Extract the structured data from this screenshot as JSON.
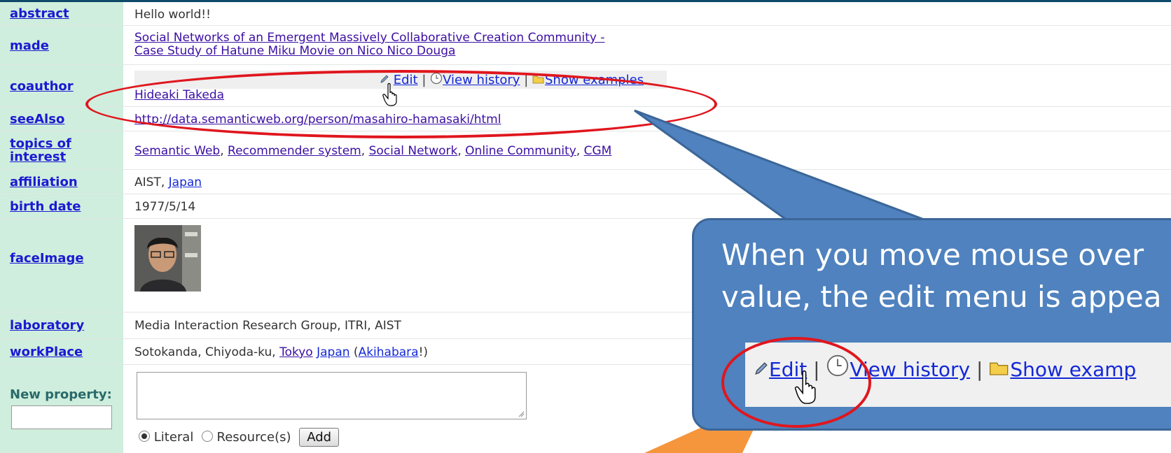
{
  "rows": {
    "abstract": {
      "label": "abstract",
      "value": "Hello world!!"
    },
    "made": {
      "label": "made",
      "link_line1": "Social Networks of an Emergent Massively Collaborative Creation Community -",
      "link_line2": "Case Study of Hatune Miku Movie on Nico Nico Douga"
    },
    "coauthor": {
      "label": "coauthor",
      "value": "Hideaki Takeda"
    },
    "seeAlso": {
      "label": "seeAlso",
      "value": "http://data.semanticweb.org/person/masahiro-hamasaki/html"
    },
    "topics": {
      "label_line1": "topics of",
      "label_line2": "interest",
      "items": [
        "Semantic Web",
        "Recommender system",
        "Social Network",
        "Online Community",
        "CGM"
      ],
      "sep": ", "
    },
    "affiliation": {
      "label": "affiliation",
      "prefix": "AIST, ",
      "link": "Japan"
    },
    "birth_date": {
      "label": "birth date",
      "value": "1977/5/14"
    },
    "faceImage": {
      "label": "faceImage"
    },
    "laboratory": {
      "label": "laboratory",
      "value": "Media Interaction Research Group, ITRI, AIST"
    },
    "workPlace": {
      "label": "workPlace",
      "prefix": "Sotokanda, Chiyoda-ku, ",
      "link1": "Tokyo",
      "link2": "Japan",
      "open": " (",
      "link3": "Akihabara",
      "close": "!)"
    }
  },
  "edit_menu": {
    "edit": "Edit",
    "sep": " | ",
    "history": "View history",
    "examples": "Show examples",
    "examples_clipped": "Show examp"
  },
  "new_property": {
    "label": "New property:",
    "literal": "Literal",
    "resource": "Resource(s)",
    "add": "Add"
  },
  "callout": {
    "line1": "When you move mouse over",
    "line2": "value, the edit menu is appea"
  },
  "colors": {
    "callout_fill": "#4f82be",
    "ellipse": "#e0161e",
    "arrow_orange": "#f5963c",
    "label_bg": "#cfeedd"
  }
}
